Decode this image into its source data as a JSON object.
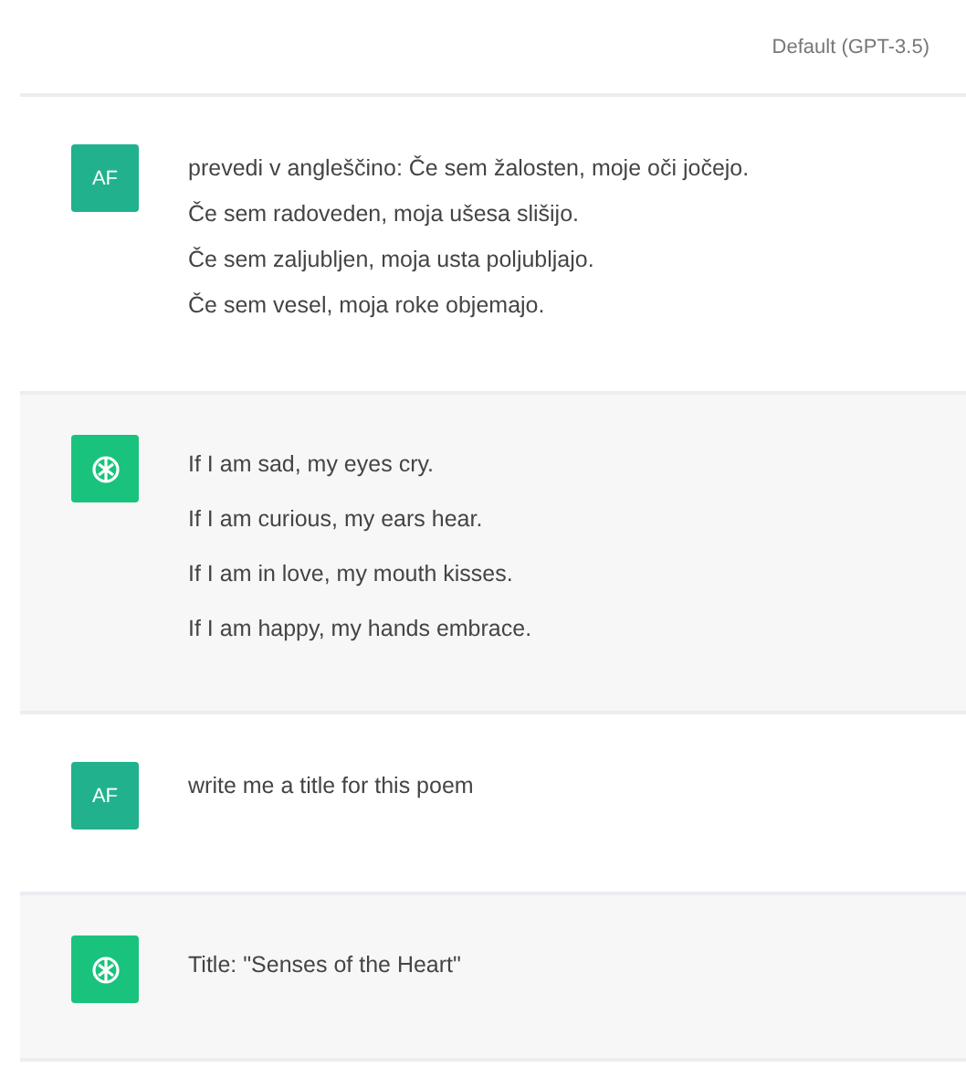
{
  "header": {
    "model": "Default (GPT-3.5)"
  },
  "messages": [
    {
      "kind": "user",
      "avatar": "AF",
      "lines": [
        "prevedi v angleščino: Če sem žalosten, moje oči jočejo.",
        "Če sem radoveden, moja ušesa slišijo.",
        "Če sem zaljubljen, moja usta poljubljajo.",
        "Če sem vesel, moja roke objemajo."
      ]
    },
    {
      "kind": "assistant",
      "lines": [
        "If I am sad, my eyes cry.",
        "If I am curious, my ears hear.",
        "If I am in love, my mouth kisses.",
        "If I am happy, my hands embrace."
      ]
    },
    {
      "kind": "user",
      "avatar": "AF",
      "lines": [
        "write me a title for this poem"
      ]
    },
    {
      "kind": "assistant",
      "lines": [
        "Title: \"Senses of the Heart\""
      ]
    }
  ]
}
